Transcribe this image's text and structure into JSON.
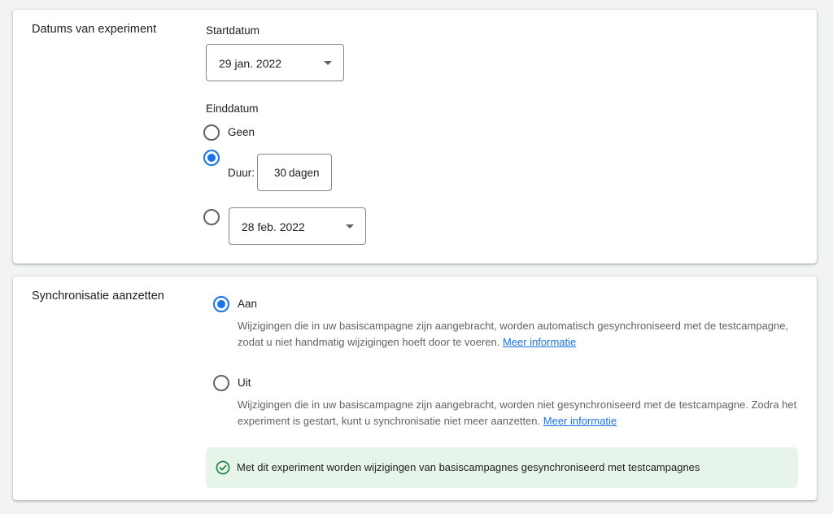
{
  "experiment_dates": {
    "section_title": "Datums van experiment",
    "start_label": "Startdatum",
    "start_date": "29 jan. 2022",
    "end_label": "Einddatum",
    "option_none": "Geen",
    "duration_label": "Duur:",
    "duration_value": "30",
    "duration_unit": "dagen",
    "end_date": "28 feb. 2022",
    "selected_end_option": "duration"
  },
  "sync": {
    "section_title": "Synchronisatie aanzetten",
    "on_label": "Aan",
    "on_description": "Wijzigingen die in uw basiscampagne zijn aangebracht, worden automatisch gesynchroniseerd met de testcampagne, zodat u niet handmatig wijzigingen hoeft door te voeren.",
    "on_link": "Meer informatie",
    "off_label": "Uit",
    "off_description": "Wijzigingen die in uw basiscampagne zijn aangebracht, worden niet gesynchroniseerd met de testcampagne. Zodra het experiment is gestart, kunt u synchronisatie niet meer aanzetten.",
    "off_link": "Meer informatie",
    "selected": "on",
    "notice_text": "Met dit experiment worden wijzigingen van basiscampagnes gesynchroniseerd met testcampagnes"
  },
  "colors": {
    "accent": "#1a73e8",
    "success": "#188038",
    "notice_bg": "#e6f4ea"
  }
}
